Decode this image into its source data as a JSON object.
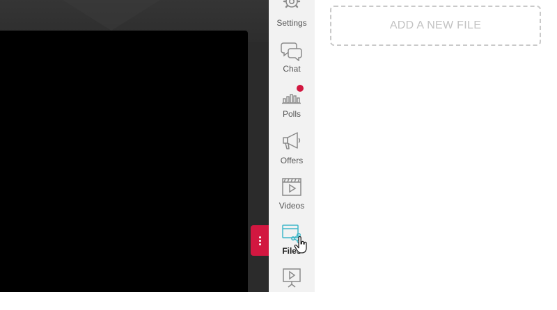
{
  "sidebar": {
    "items": [
      {
        "label": "Settings",
        "icon": "gear-icon"
      },
      {
        "label": "Chat",
        "icon": "chat-bubbles-icon"
      },
      {
        "label": "Polls",
        "icon": "bar-chart-icon",
        "badge": true
      },
      {
        "label": "Offers",
        "icon": "megaphone-icon"
      },
      {
        "label": "Videos",
        "icon": "video-clapper-icon"
      },
      {
        "label": "Files",
        "icon": "files-share-icon",
        "active": true
      },
      {
        "label": "",
        "icon": "presentation-icon"
      }
    ]
  },
  "main": {
    "add_file_label": "ADD A NEW FILE"
  },
  "colors": {
    "accent": "#d21740",
    "files_icon_accent": "#3fb8c9",
    "sidebar_bg": "#f2f2f2",
    "stage_bg": "#2b2b2b"
  }
}
